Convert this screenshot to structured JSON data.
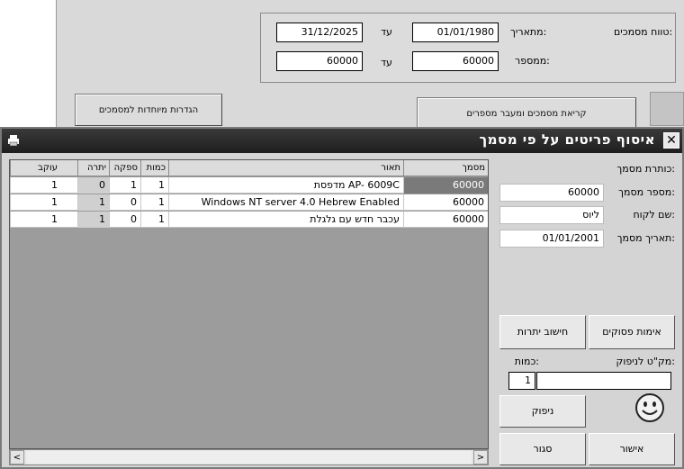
{
  "background_form": {
    "date_range_label": "טווח מסמכים:",
    "from_date_label": "מתאריך:",
    "to_label_1": "עד",
    "from_date": "01/01/1980",
    "to_date": "31/12/2025",
    "number_label": "ממספר:",
    "to_label_2": "עד",
    "from_number": "60000",
    "to_number": "60000",
    "special_definitions_button": "הגדרות מיוחדות למסמכים",
    "read_docs_button": "קריאת מסמכים ומעבר מספרים"
  },
  "dialog": {
    "title": "איסוף פריטים על פי מסמך",
    "close_symbol": "✕",
    "grid": {
      "headers": [
        "מסמך",
        "תאור",
        "כמות",
        "ספקה",
        "יתרה",
        "עוקב"
      ],
      "rows": [
        {
          "doc": "60000",
          "desc": "מדפסת AP- 6009C",
          "qty": "1",
          "supplied": "1",
          "balance": "0",
          "track": "1"
        },
        {
          "doc": "60000",
          "desc": "Windows NT server 4.0 Hebrew Enabled",
          "qty": "1",
          "supplied": "0",
          "balance": "1",
          "track": "1"
        },
        {
          "doc": "60000",
          "desc": "עכבר חדש עם גלגלת",
          "qty": "1",
          "supplied": "0",
          "balance": "1",
          "track": "1"
        }
      ]
    },
    "scroll": {
      "left_arrow": "<",
      "right_arrow": ">"
    },
    "panel": {
      "doc_title_label": "כותרת מסמך:",
      "doc_number_label": "מספר מסמך:",
      "doc_number": "60000",
      "customer_label": "שם לקוח:",
      "customer": "ליוס",
      "doc_date_label": "תאריך מסמך:",
      "doc_date": "01/01/2001",
      "confirm_items_button": "אימות פסוקים",
      "calc_balance_button": "חישוב יתרות",
      "sku_label": "מק\"ט לניפוק:",
      "qty_label": "כמות:",
      "qty_value": "1",
      "sku_value": "",
      "issue_button": "ניפוק",
      "approve_button": "אישור",
      "close_button": "סגור"
    }
  }
}
